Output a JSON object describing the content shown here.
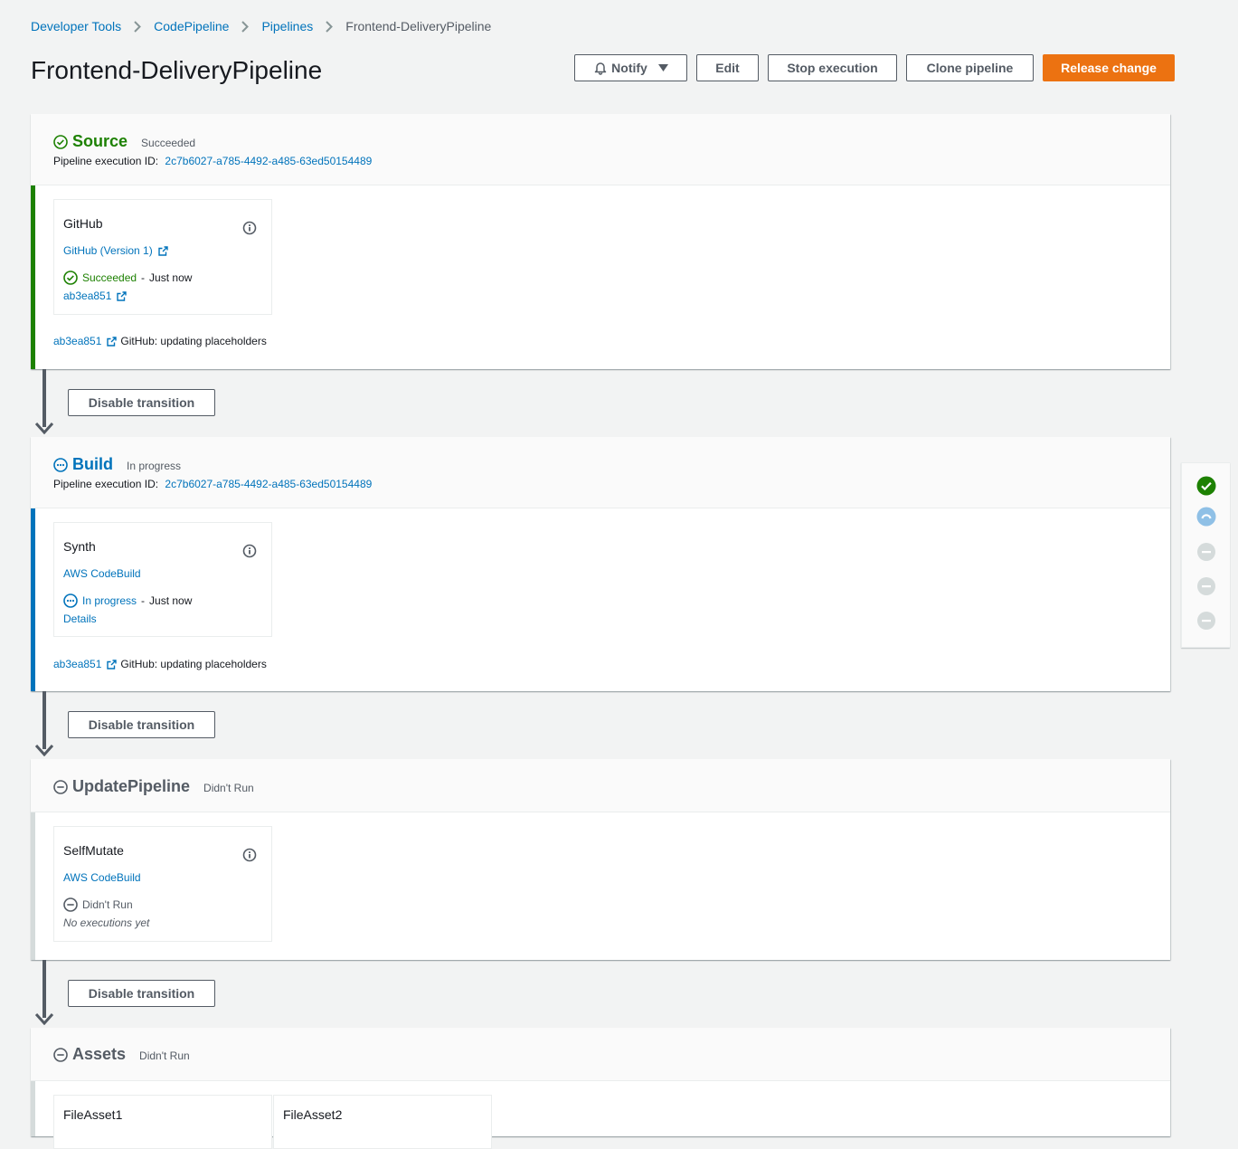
{
  "breadcrumb": {
    "items": [
      "Developer Tools",
      "CodePipeline",
      "Pipelines"
    ],
    "current": "Frontend-DeliveryPipeline"
  },
  "page_title": "Frontend-DeliveryPipeline",
  "header_buttons": {
    "notify": "Notify",
    "edit": "Edit",
    "stop": "Stop execution",
    "clone": "Clone pipeline",
    "release": "Release change"
  },
  "colors": {
    "success": "#1d8102",
    "in_progress": "#0073bb",
    "didnt_run": "#aab7b8",
    "primary_button": "#ec7211"
  },
  "exec_label": "Pipeline execution ID:",
  "transition_button": "Disable transition",
  "stages": [
    {
      "name": "Source",
      "status": "Succeeded",
      "execution_id": "2c7b6027-a785-4492-a485-63ed50154489",
      "action": {
        "name": "GitHub",
        "provider": "GitHub (Version 1)",
        "status": "Succeeded",
        "time": "Just now",
        "sub_link": "ab3ea851"
      },
      "commit": {
        "id": "ab3ea851",
        "message": "GitHub: updating placeholders"
      }
    },
    {
      "name": "Build",
      "status": "In progress",
      "execution_id": "2c7b6027-a785-4492-a485-63ed50154489",
      "action": {
        "name": "Synth",
        "provider": "AWS CodeBuild",
        "status": "In progress",
        "time": "Just now",
        "sub_link": "Details"
      },
      "commit": {
        "id": "ab3ea851",
        "message": "GitHub: updating placeholders"
      }
    },
    {
      "name": "UpdatePipeline",
      "status": "Didn't Run",
      "action": {
        "name": "SelfMutate",
        "provider": "AWS CodeBuild",
        "status": "Didn't Run",
        "sub_text": "No executions yet"
      }
    },
    {
      "name": "Assets",
      "status": "Didn't Run",
      "actions": [
        "FileAsset1",
        "FileAsset2"
      ]
    }
  ],
  "mini_status": [
    "succeeded",
    "in-progress",
    "didnt-run",
    "didnt-run",
    "didnt-run"
  ]
}
